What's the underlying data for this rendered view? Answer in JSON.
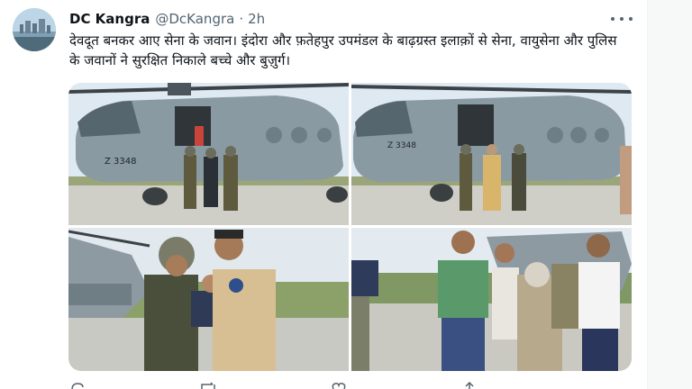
{
  "tweet": {
    "author_name": "DC Kangra",
    "handle": "@DcKangra",
    "separator": "·",
    "time": "2h",
    "text": "देवदूत बनकर आए सेना के जवान। इंदोरा और फ़तेहपुर उपमंडल के बाढ़ग्रस्त इलाक़ों से सेना, वायुसेना और पुलिस के जवानों ने सुरक्षित निकाले बच्चे और बुज़ुर्ग।",
    "helicopter_tail_number_1": "Z 3348",
    "helicopter_tail_number_2": "Z 3348"
  },
  "icons": {
    "more": "more-horizontal-icon",
    "reply": "reply-icon",
    "retweet": "retweet-icon",
    "like": "like-icon",
    "share": "share-icon"
  },
  "colors": {
    "text": "#0f1419",
    "secondary": "#536471",
    "helicopter": "#8a9aa3",
    "sky": "#dfe9f1",
    "ground": "#cfcfc7"
  }
}
